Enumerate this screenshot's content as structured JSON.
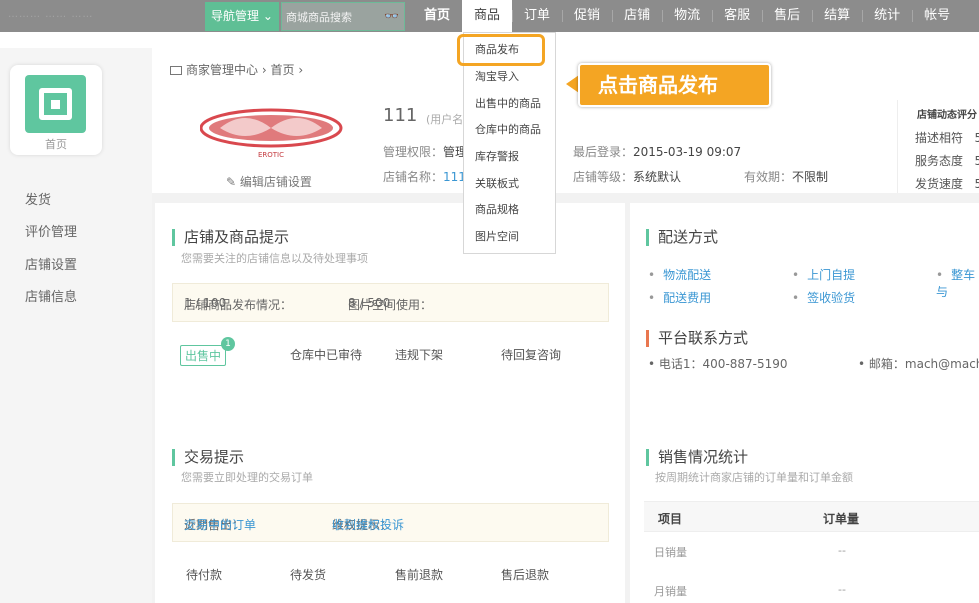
{
  "topbar": {
    "logo_text": "………  …… ……",
    "nav_manage_label": "导航管理",
    "search_placeholder": "商城商品搜索",
    "nav_items": [
      "首页",
      "商品",
      "订单",
      "促销",
      "店铺",
      "物流",
      "客服",
      "售后",
      "结算",
      "统计",
      "帐号"
    ]
  },
  "dropdown": {
    "items": [
      "商品发布",
      "淘宝导入",
      "出售中的商品",
      "仓库中的商品",
      "库存警报",
      "关联板式",
      "商品规格",
      "图片空间"
    ]
  },
  "callout": {
    "text": "点击商品发布"
  },
  "sidebar": {
    "home_label": "首页",
    "items": [
      "发货",
      "评价管理",
      "店铺设置",
      "店铺信息"
    ]
  },
  "breadcrumb": {
    "part1": "商家管理中心",
    "sep": "›",
    "part2": "首页",
    "sep2": "›"
  },
  "store": {
    "logo_text": "EROTIC",
    "edit_label": "编辑店铺设置",
    "name": "111",
    "user_tag": "(用户名",
    "perm_label": "管理权限：",
    "perm_value": "管理",
    "shop_label": "店铺名称：",
    "shop_value": "111",
    "last_login_label": "最后登录：",
    "last_login_value": "2015-03-19 09:07",
    "level_label": "店铺等级：",
    "level_value": "系统默认",
    "valid_label": "有效期：",
    "valid_value": "不限制"
  },
  "rating": {
    "title": "店铺动态评分",
    "items": [
      {
        "label": "描述相符",
        "value": "5"
      },
      {
        "label": "服务态度",
        "value": "5"
      },
      {
        "label": "发货速度",
        "value": "5"
      }
    ]
  },
  "store_tips": {
    "title": "店铺及商品提示",
    "subtitle": "您需要关注的店铺信息以及待处理事项",
    "pub_label": "店铺商品发布情况：",
    "pub_value": "1 / 100",
    "img_label": "图片空间使用：",
    "img_value": "8 / 500",
    "tabs": [
      "出售中",
      "仓库中已审待",
      "违规下架",
      "待回复咨询"
    ],
    "badge": "1"
  },
  "trade_tips": {
    "title": "交易提示",
    "subtitle": "您需要立即处理的交易订单",
    "recent_label": "近期售出：",
    "recent_link": "交易中的订单",
    "rights_label": "维权提示：",
    "rights_link": "收到维权投诉",
    "tabs": [
      "待付款",
      "待发货",
      "售前退款",
      "售后退款"
    ]
  },
  "delivery": {
    "title": "配送方式",
    "links": [
      "物流配送",
      "上门自提",
      "整车与",
      "配送费用",
      "签收验货"
    ]
  },
  "contact": {
    "title": "平台联系方式",
    "phone": "电话1：400-887-5190",
    "email": "邮箱：mach@mach-"
  },
  "sales": {
    "title": "销售情况统计",
    "subtitle": "按周期统计商家店铺的订单量和订单金额",
    "col1": "项目",
    "col2": "订单量",
    "rows": [
      {
        "name": "日销量",
        "value": "--"
      },
      {
        "name": "月销量",
        "value": "--"
      }
    ]
  }
}
